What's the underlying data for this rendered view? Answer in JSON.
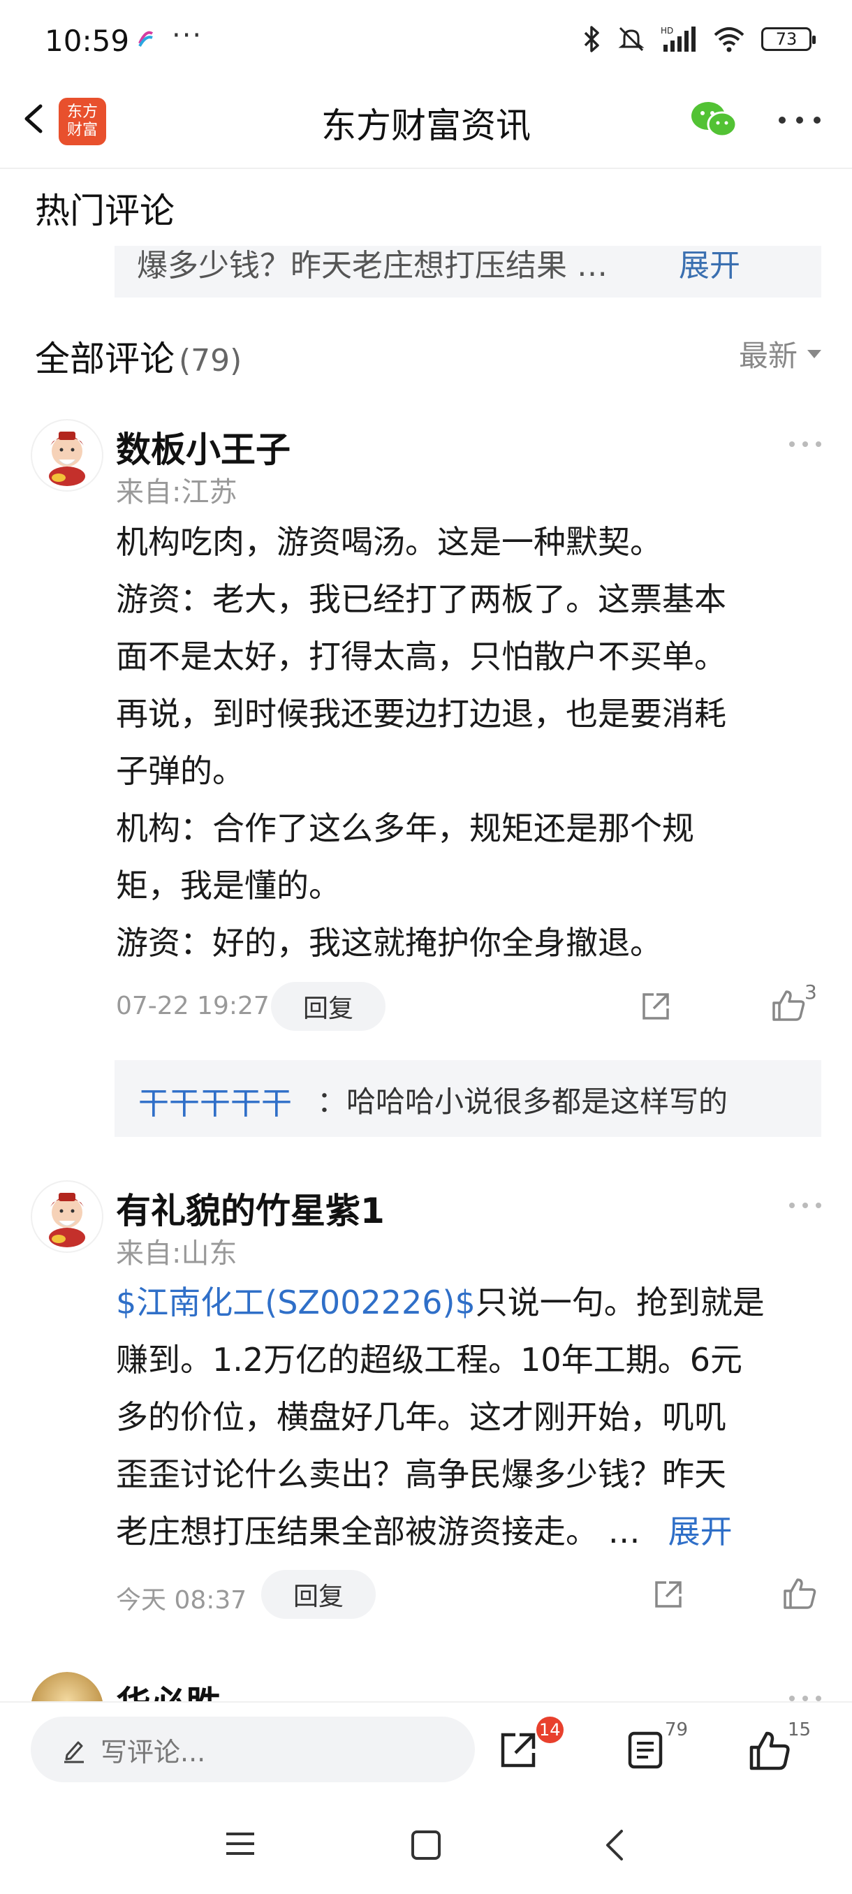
{
  "status_bar": {
    "time": "10:59",
    "dots": "···",
    "battery": "73",
    "icons": [
      "app-notification-icon",
      "bluetooth-icon",
      "mute-icon",
      "hd-signal-icon",
      "wifi-icon",
      "battery-icon"
    ]
  },
  "header": {
    "title": "东方财富资讯",
    "logo_line1": "东方",
    "logo_line2": "财富",
    "icons": [
      "back-icon",
      "app-logo",
      "wechat-icon",
      "more-icon"
    ]
  },
  "hot_comments": {
    "title": "热门评论",
    "preview_text": "爆多少钱？昨天老庄想打压结果 …",
    "expand": "展开"
  },
  "all_comments": {
    "title": "全部评论",
    "count": "(79)",
    "sort_label": "最新"
  },
  "comments": [
    {
      "username": "数板小王子",
      "location": "来自:江苏",
      "lines": [
        "机构吃肉，游资喝汤。这是一种默契。",
        "游资：老大，我已经打了两板了。这票基本",
        "面不是太好，打得太高，只怕散户不买单。",
        "再说，到时候我还要边打边退，也是要消耗",
        "子弹的。",
        "机构：合作了这么多年，规矩还是那个规",
        "矩，我是懂的。",
        "游资：好的，我这就掩护你全身撤退。"
      ],
      "timestamp": "07-22 19:27",
      "reply_label": "回复",
      "likes": "3",
      "sub_reply": {
        "user": "干干干干干",
        "text": "：哈哈哈小说很多都是这样写的"
      }
    },
    {
      "username": "有礼貌的竹星紫1",
      "location": "来自:山东",
      "stock": "$江南化工(SZ002226)$",
      "lines": [
        "只说一句。抢到就是",
        "赚到。1.2万亿的超级工程。10年工期。6元",
        "多的价位，横盘好几年。这才刚开始，叽叽",
        "歪歪讨论什么卖出？高争民爆多少钱？昨天",
        "老庄想打压结果全部被游资接走。 …"
      ],
      "expand": "展开",
      "timestamp": "今天 08:37",
      "reply_label": "回复"
    },
    {
      "username": "华必胜"
    }
  ],
  "bottom_bar": {
    "input_placeholder": "写评论...",
    "share_badge": "14",
    "comment_count": "79",
    "like_count": "15"
  },
  "nav_bar": {
    "icons": [
      "menu-icon",
      "home-icon",
      "back-nav-icon"
    ]
  },
  "colors": {
    "accent_blue": "#2f6fc8",
    "logo_orange": "#e8502d",
    "wechat_green": "#52c234",
    "badge_red": "#e8402d"
  }
}
